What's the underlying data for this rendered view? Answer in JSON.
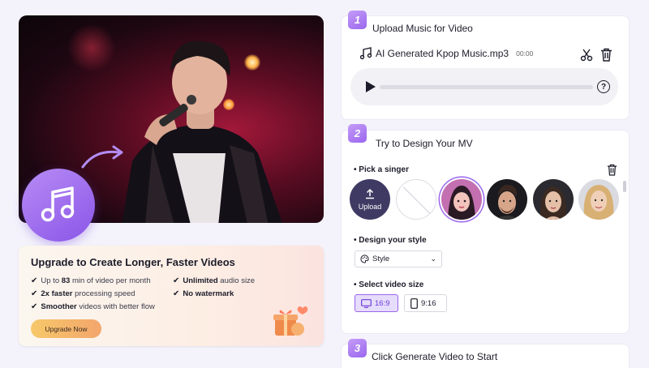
{
  "left": {
    "hero_alt": "",
    "upgrade": {
      "title": "Upgrade to Create Longer, Faster Videos",
      "features": [
        {
          "pre": "Up to ",
          "bold": "83",
          "post": " min of video per month"
        },
        {
          "pre": "",
          "bold": "Unlimited",
          "post": " audio size"
        },
        {
          "pre": "",
          "bold": "2x faster",
          "post": " processing speed"
        },
        {
          "pre": "",
          "bold": "No watermark",
          "post": ""
        },
        {
          "pre": "",
          "bold": "Smoother",
          "post": " videos with better flow"
        }
      ],
      "button_label": "Upgrade Now"
    }
  },
  "steps": {
    "step1": {
      "number": "1",
      "title": "Upload Music for Video",
      "file_name": "AI Generated Kpop Music.mp3",
      "duration": "00:00",
      "help_glyph": "?"
    },
    "step2": {
      "number": "2",
      "title": "Try to Design Your MV",
      "pick_singer_label": "• Pick a singer",
      "upload_label": "Upload",
      "style_label": "• Design your style",
      "style_value": "Style",
      "size_label": "• Select video size",
      "size_options": [
        "16:9",
        "9:16"
      ],
      "selected_size": "16:9"
    },
    "step3": {
      "number": "3",
      "title": "Click Generate Video to Start"
    }
  },
  "colors": {
    "accent": "#9a66ee",
    "accent_light": "#e6dcfb",
    "background": "#f4f3fb",
    "upgrade_button": "#f5b86b"
  },
  "icons": [
    "music-note-icon",
    "scissors-icon",
    "trash-icon",
    "play-icon",
    "help-icon",
    "upload-icon",
    "palette-icon",
    "chevron-down-icon",
    "monitor-icon",
    "phone-icon",
    "gift-icon",
    "check-icon"
  ]
}
